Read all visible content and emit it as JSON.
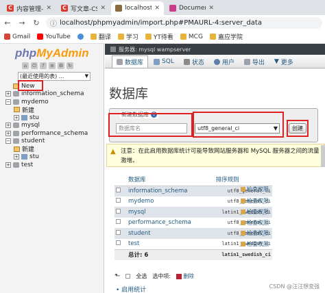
{
  "browser": {
    "tabs": [
      {
        "label": "内容管理-CS",
        "favicon": "C"
      },
      {
        "label": "写文章-CS",
        "favicon": "C"
      },
      {
        "label": "localhost",
        "favicon": "pma",
        "active": true
      },
      {
        "label": "Documen",
        "favicon": "dash"
      }
    ],
    "url": "localhost/phpmyadmin/import.php#PMAURL-4:server_data",
    "bookmarks": [
      "Gmail",
      "YouTube",
      "",
      "翻译",
      "学习",
      "YT待看",
      "MCG",
      "嘉应学院"
    ]
  },
  "leftnav": {
    "logo_php": "php",
    "logo_my": "MyAdmin",
    "recent_label": "(最近使用的表) ...",
    "tree": [
      {
        "label": "New",
        "level": 0,
        "kind": "new"
      },
      {
        "label": "information_schema",
        "level": 0,
        "kind": "db"
      },
      {
        "label": "mydemo",
        "level": 0,
        "kind": "db",
        "expanded": true
      },
      {
        "label": "新建",
        "level": 1,
        "kind": "new"
      },
      {
        "label": "stu",
        "level": 1,
        "kind": "table"
      },
      {
        "label": "mysql",
        "level": 0,
        "kind": "db"
      },
      {
        "label": "performance_schema",
        "level": 0,
        "kind": "db"
      },
      {
        "label": "student",
        "level": 0,
        "kind": "db",
        "expanded": true
      },
      {
        "label": "新建",
        "level": 1,
        "kind": "new"
      },
      {
        "label": "stu",
        "level": 1,
        "kind": "table"
      },
      {
        "label": "test",
        "level": 0,
        "kind": "db"
      }
    ]
  },
  "main": {
    "serverbar": "服务器: mysql wampserver",
    "menutabs": [
      {
        "label": "数据库",
        "active": true
      },
      {
        "label": "SQL"
      },
      {
        "label": "状态"
      },
      {
        "label": "用户"
      },
      {
        "label": "导出"
      },
      {
        "label": "更多"
      }
    ],
    "page_title": "数据库",
    "create": {
      "legend": "新建数据库",
      "name_placeholder": "数据库名",
      "collation": "utf8_general_ci",
      "button": "创建"
    },
    "notice": "注意：在此启用数据库统计可能导致网站服务器和 MySQL 服务器之间的流量激增。",
    "table": {
      "headers": [
        "数据库",
        "排序规则",
        ""
      ],
      "rows": [
        {
          "name": "information_schema",
          "collation": "utf8_general_ci",
          "action": "检查权限"
        },
        {
          "name": "mydemo",
          "collation": "utf8_general_ci",
          "action": "检查权限"
        },
        {
          "name": "mysql",
          "collation": "latin1_swedish_ci",
          "action": "检查权限"
        },
        {
          "name": "performance_schema",
          "collation": "utf8_general_ci",
          "action": "检查权限"
        },
        {
          "name": "student",
          "collation": "utf8_general_ci",
          "action": "检查权限"
        },
        {
          "name": "test",
          "collation": "latin1_swedish_ci",
          "action": "检查权限"
        }
      ],
      "total_label": "总计: 6",
      "total_collation": "latin1_swedish_ci"
    },
    "check_all": "全选",
    "with_selected": "选中项:",
    "delete": "删除",
    "enable_stats": "启用统计"
  },
  "watermark": "CSDN @汪汪想变强"
}
